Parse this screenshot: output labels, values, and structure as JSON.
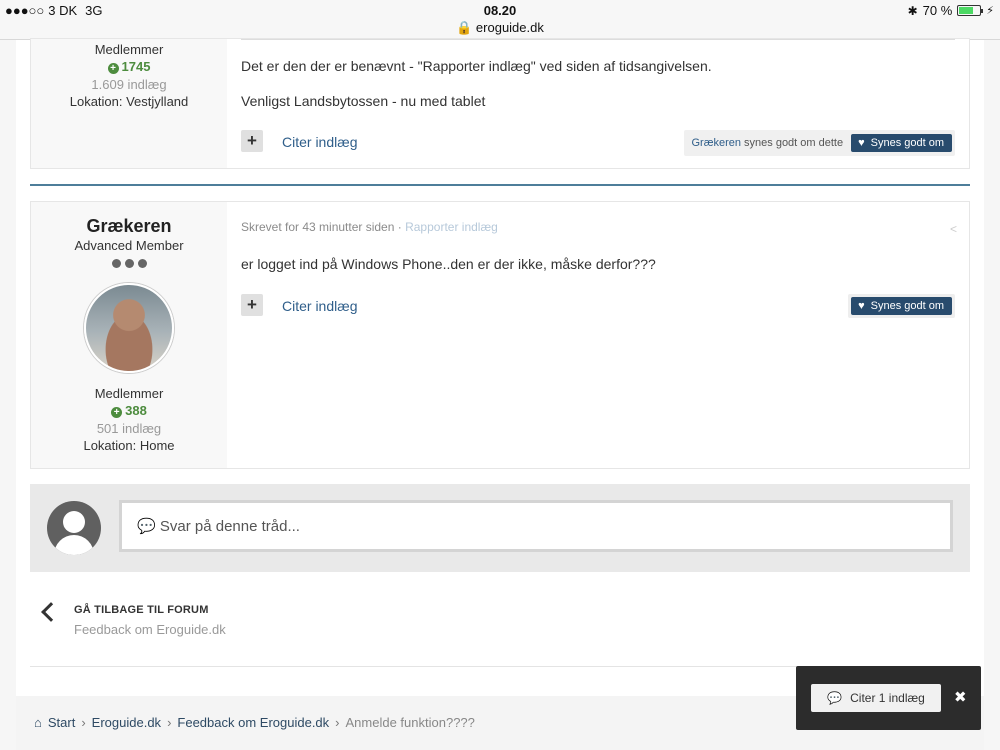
{
  "status_bar": {
    "carrier": "3 DK",
    "network": "3G",
    "time": "08.20",
    "url": "eroguide.dk",
    "battery": "70 %",
    "battery_level": 0.7
  },
  "post1": {
    "group": "Medlemmer",
    "reputation": "1745",
    "posts": "1.609 indlæg",
    "location": "Lokation: Vestjylland",
    "lines": [
      "Det er den der er benævnt - \"Rapporter indlæg\" ved siden af tidsangivelsen.",
      "Venligst Landsbytossen - nu med tablet"
    ],
    "quote_label": "Citer indlæg",
    "reaction_user": "Grækeren",
    "reaction_text": "synes godt om dette",
    "like_label": "Synes godt om"
  },
  "post2": {
    "username": "Grækeren",
    "rank": "Advanced Member",
    "group": "Medlemmer",
    "reputation": "388",
    "posts": "501 indlæg",
    "location": "Lokation: Home",
    "meta_time": "Skrevet for 43 minutter siden",
    "meta_sep": "·",
    "report_label": "Rapporter indlæg",
    "text": "er logget ind på Windows Phone..den er der ikke, måske derfor???",
    "quote_label": "Citer indlæg",
    "like_label": "Synes godt om"
  },
  "reply": {
    "placeholder": "Svar på denne tråd..."
  },
  "back": {
    "title": "GÅ TILBAGE TIL FORUM",
    "subtitle": "Feedback om Eroguide.dk"
  },
  "breadcrumb": {
    "items": [
      "Start",
      "Eroguide.dk",
      "Feedback om Eroguide.dk"
    ],
    "current": "Anmelde funktion????"
  },
  "floatbar": {
    "label": "Citer 1 indlæg"
  }
}
